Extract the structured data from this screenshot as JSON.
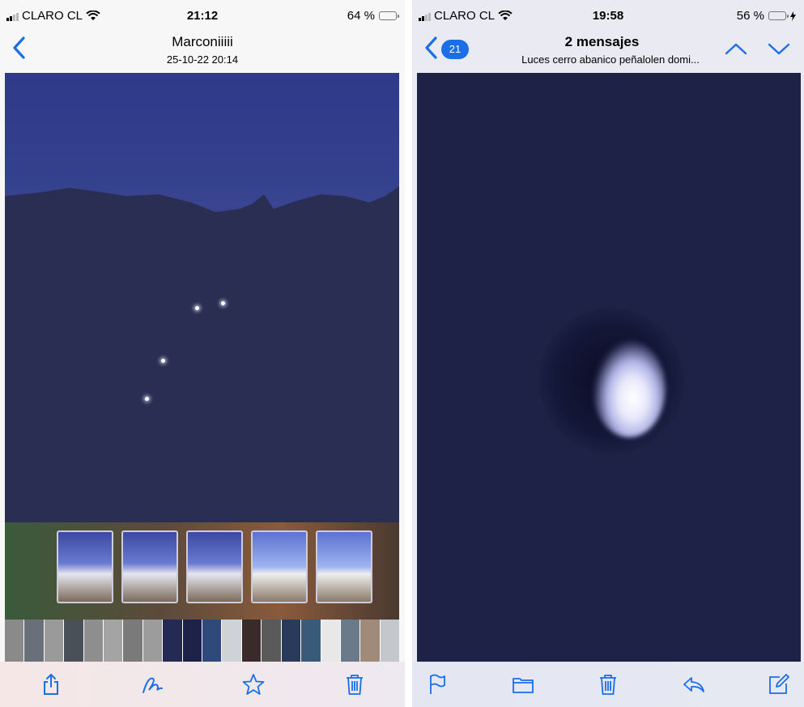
{
  "left_screen": {
    "status": {
      "carrier": "CLARO CL",
      "time": "21:12",
      "battery_text": "64 %",
      "battery_level": 0.64
    },
    "nav": {
      "title": "Marconiiiii",
      "subtitle": "25-10-22 20:14"
    },
    "toolbar": {
      "icons": [
        "share-icon",
        "markup-icon",
        "star-icon",
        "trash-icon"
      ]
    },
    "accent": "#1a6ee8"
  },
  "right_screen": {
    "status": {
      "carrier": "CLARO CL",
      "time": "19:58",
      "battery_text": "56 %",
      "battery_level": 0.56,
      "charging": true
    },
    "nav": {
      "badge": "21",
      "title": "2 mensajes",
      "subtitle": "Luces cerro abanico peñalolen domi..."
    },
    "toolbar": {
      "icons": [
        "flag-icon",
        "folder-icon",
        "trash-icon",
        "reply-icon",
        "compose-icon"
      ]
    },
    "accent": "#1a6ee8",
    "battery_color": "#34c759"
  }
}
